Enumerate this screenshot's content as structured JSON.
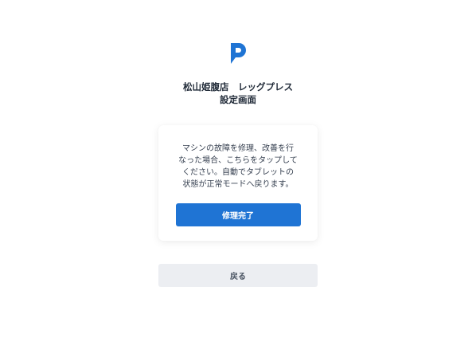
{
  "brand": {
    "logo_icon": "brand-p-logo-icon",
    "accent_color": "#1f74d4"
  },
  "header": {
    "title_line1": "松山姫腹店　レッグプレス",
    "title_line2": "設定画面"
  },
  "card": {
    "message_lines": [
      "マシンの故障を修理、改善を行",
      "なった場合、こちらをタップして",
      "ください。自動でタブレットの",
      "状態が正常モードへ戻ります。"
    ],
    "complete_button_label": "修理完了"
  },
  "footer": {
    "back_button_label": "戻る"
  }
}
